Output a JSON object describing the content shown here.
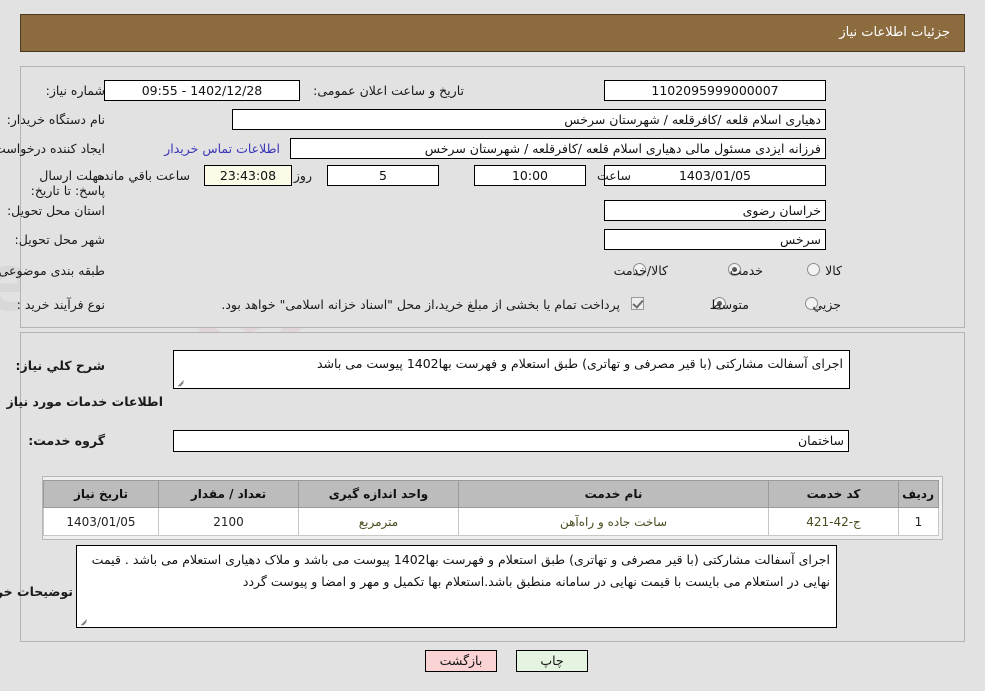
{
  "header": {
    "title": "جزئیات اطلاعات نیاز",
    "bar_color": "#8c6b3f"
  },
  "info_panel": {
    "need_number": {
      "label": "شماره نیاز:",
      "value": "1102095999000007"
    },
    "announce_datetime": {
      "label": "تاریخ و ساعت اعلان عمومی:",
      "value": "1402/12/28 - 09:55"
    },
    "buyer_org": {
      "label": "نام دستگاه خریدار:",
      "value": "دهیاری اسلام قلعه /کافرقلعه / شهرستان سرخس"
    },
    "request_creator": {
      "label": "ایجاد کننده درخواست:",
      "value": "فرزانه ایزدی مسئول مالی دهیاری اسلام قلعه /کافرقلعه / شهرستان سرخس"
    },
    "buyer_contact_link": "اطلاعات تماس خریدار",
    "deadline": {
      "label": "مهلت ارسال پاسخ: تا تاریخ:",
      "date": "1403/01/05",
      "time_label": "ساعت",
      "time": "10:00",
      "days_remaining": "5",
      "days_unit_label": "روز و",
      "countdown": "23:43:08",
      "countdown_suffix_label": "ساعت باقي مانده"
    },
    "delivery_province": {
      "label": "استان محل تحویل:",
      "value": "خراسان رضوی"
    },
    "delivery_city": {
      "label": "شهر محل تحویل:",
      "value": "سرخس"
    },
    "subject_category": {
      "label": "طبقه بندی موضوعی:",
      "options": [
        {
          "label": "کالا",
          "selected": false
        },
        {
          "label": "خدمت",
          "selected": true
        },
        {
          "label": "کالا/خدمت",
          "selected": false
        }
      ]
    },
    "purchase_process": {
      "label": "نوع فرآیند خرید :",
      "options": [
        {
          "label": "جزیي",
          "selected": false
        },
        {
          "label": "متوسط",
          "selected": true
        }
      ],
      "treasury_checkbox": {
        "checked": true,
        "label": "پرداخت تمام یا بخشی از مبلغ خرید،از محل \"اسناد خزانه اسلامی\" خواهد بود."
      }
    }
  },
  "detail_panel": {
    "general_description": {
      "label": "شرح کلي نیاز:",
      "value": "اجرای آسفالت مشارکتی (با قیر مصرفی و تهاتری) طبق استعلام و فهرست بها1402 پیوست می باشد"
    },
    "services_section_heading": "اطلاعات خدمات مورد نیاز",
    "service_group": {
      "label": "گروه خدمت:",
      "value": "ساختمان"
    },
    "table": {
      "columns": [
        "ردیف",
        "کد خدمت",
        "نام خدمت",
        "واحد اندازه گیری",
        "تعداد / مقدار",
        "تاریخ نیاز"
      ],
      "rows": [
        {
          "row_no": "1",
          "service_code": "ج-42-421",
          "service_name": "ساخت جاده و راه‌آهن",
          "unit": "مترمربع",
          "quantity": "2100",
          "need_date": "1403/01/05"
        }
      ]
    },
    "buyer_comments": {
      "label": "توضیحات خریدار:",
      "value": "اجرای آسفالت مشارکتی (با قیر مصرفی و تهاتری) طبق استعلام و فهرست بها1402 پیوست می باشد و ملاک دهیاری استعلام می باشد . قیمت نهایی در استعلام می بایست با قیمت نهایی در سامانه منطبق باشد.استعلام بها تکمیل و مهر و امضا و پیوست گردد"
    }
  },
  "footer": {
    "back_button": "بازگشت",
    "print_button": "چاپ",
    "back_color": "#fad4d4",
    "print_color": "#e4f4e0"
  }
}
